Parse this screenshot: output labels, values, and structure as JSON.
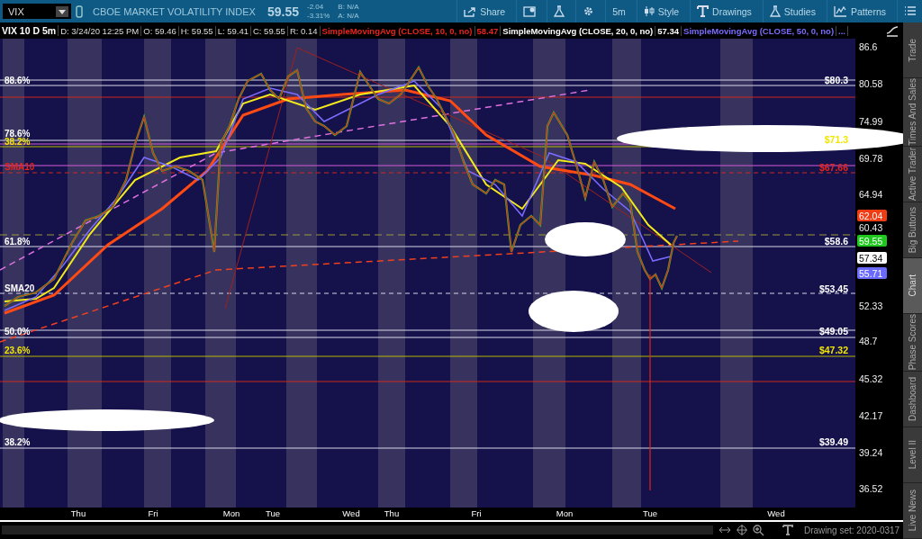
{
  "toolbar": {
    "symbol": "VIX",
    "description": "CBOE MARKET VOLATILITY INDEX",
    "last": "59.55",
    "change": "-2.04",
    "change_pct": "-3.31%",
    "bid": "B: N/A",
    "ask": "A: N/A",
    "buttons": [
      {
        "label": "Share"
      },
      {
        "label": "5m"
      },
      {
        "label": "Style"
      },
      {
        "label": "Drawings"
      },
      {
        "label": "Studies"
      },
      {
        "label": "Patterns"
      }
    ]
  },
  "info_bar": {
    "title": "VIX 10 D 5m",
    "fields": [
      "D: 3/24/20 12:25 PM",
      "O: 59.46",
      "H: 59.55",
      "L: 59.41",
      "C: 59.55",
      "R: 0.14"
    ],
    "studies": [
      {
        "name": "SimpleMovingAvg (CLOSE, 10, 0, no)",
        "value": "58.47",
        "color": "#e8241c"
      },
      {
        "name": "SimpleMovingAvg (CLOSE, 20, 0, no)",
        "value": "57.34",
        "color": "#ffffff"
      },
      {
        "name": "SimpleMovingAvg (CLOSE, 50, 0, no)",
        "value": "...",
        "color": "#7b6cff"
      }
    ]
  },
  "chart": {
    "left_labels": [
      {
        "text": "88.6%",
        "color": "#ffffff"
      },
      {
        "text": "78.6%",
        "color": "#ffffff"
      },
      {
        "text": "38.2%",
        "color": "#f2e600"
      },
      {
        "text": "SMA10",
        "color": "#e8241c"
      },
      {
        "text": "61.8%",
        "color": "#ffffff"
      },
      {
        "text": "SMA20",
        "color": "#ffffff"
      },
      {
        "text": "50.0%",
        "color": "#ffffff"
      },
      {
        "text": "23.6%",
        "color": "#f2e600"
      },
      {
        "text": "38.2%",
        "color": "#ffffff"
      }
    ],
    "right_labels": [
      {
        "text": "$80.3",
        "color": "#ffffff"
      },
      {
        "text": "$71.3",
        "color": "#f2e600"
      },
      {
        "text": "$67.66",
        "color": "#e8241c"
      },
      {
        "text": "$58.6",
        "color": "#ffffff"
      },
      {
        "text": "$53.45",
        "color": "#ffffff"
      },
      {
        "text": "$49.05",
        "color": "#ffffff"
      },
      {
        "text": "$47.32",
        "color": "#f2e600"
      },
      {
        "text": "$39.49",
        "color": "#ffffff"
      }
    ],
    "price_axis": [
      "86.6",
      "80.58",
      "74.99",
      "69.78",
      "64.94",
      "60.43",
      "52.33",
      "48.7",
      "45.32",
      "42.17",
      "39.24",
      "36.52"
    ],
    "price_badges": [
      {
        "text": "62.04",
        "color": "#f03c14"
      },
      {
        "text": "59.55",
        "color": "#1ec81e"
      },
      {
        "text": "57.34",
        "color": "#ffffff"
      },
      {
        "text": "55.71",
        "color": "#6a6aff"
      }
    ],
    "time_axis": [
      "Thu",
      "Fri",
      "Mon",
      "Tue",
      "Wed",
      "Thu",
      "Fri",
      "Mon",
      "Tue",
      "Wed"
    ]
  },
  "drawing_set": "Drawing set: 2020-0317",
  "side_tabs": [
    {
      "label": "Trade",
      "selected": false
    },
    {
      "label": "Times And Sales",
      "selected": false
    },
    {
      "label": "Active Trader",
      "selected": false
    },
    {
      "label": "Big Buttons",
      "selected": false
    },
    {
      "label": "Chart",
      "selected": true
    },
    {
      "label": "Phase Scores",
      "selected": false
    },
    {
      "label": "Dashboard",
      "selected": false
    },
    {
      "label": "Level II",
      "selected": false
    },
    {
      "label": "Live News",
      "selected": false
    }
  ]
}
